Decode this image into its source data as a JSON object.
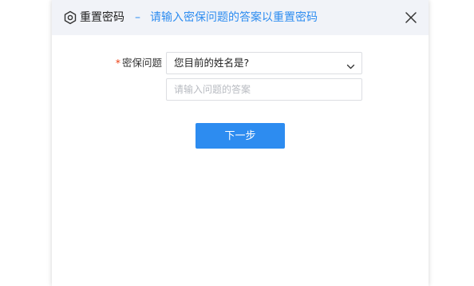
{
  "dialog": {
    "title": "重置密码",
    "subtitle_dash": "–",
    "subtitle": "请输入密保问题的答案以重置密码",
    "accent_color": "#2d8cf0"
  },
  "form": {
    "question_required_mark": "*",
    "question_label": "密保问题",
    "question_selected": "您目前的姓名是?",
    "answer_placeholder": "请输入问题的答案",
    "answer_value": ""
  },
  "actions": {
    "next_label": "下一步"
  },
  "icons": {
    "title_icon": "settings-hex-icon",
    "close_icon": "close-icon",
    "dropdown_icon": "chevron-down-icon"
  }
}
